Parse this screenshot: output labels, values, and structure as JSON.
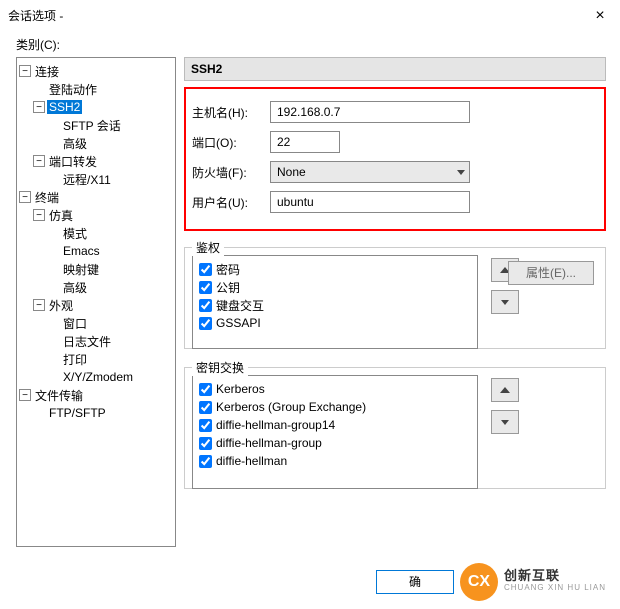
{
  "window": {
    "title": "会话选项 -",
    "close": "×"
  },
  "category_label": "类别(C):",
  "tree": {
    "n_conn": "连接",
    "n_login": "登陆动作",
    "n_ssh2": "SSH2",
    "n_sftp": "SFTP 会话",
    "n_adv1": "高级",
    "n_portfwd": "端口转发",
    "n_remote": "远程/X11",
    "n_term": "终端",
    "n_emul": "仿真",
    "n_mode": "模式",
    "n_emacs": "Emacs",
    "n_mapkey": "映射键",
    "n_adv2": "高级",
    "n_look": "外观",
    "n_win": "窗口",
    "n_log": "日志文件",
    "n_print": "打印",
    "n_xyz": "X/Y/Zmodem",
    "n_file": "文件传输",
    "n_ftp": "FTP/SFTP"
  },
  "section_title": "SSH2",
  "form": {
    "host_label": "主机名(H):",
    "host_value": "192.168.0.7",
    "port_label": "端口(O):",
    "port_value": "22",
    "fw_label": "防火墙(F):",
    "fw_value": "None",
    "user_label": "用户名(U):",
    "user_value": "ubuntu"
  },
  "auth": {
    "title": "鉴权",
    "items": [
      "密码",
      "公钥",
      "键盘交互",
      "GSSAPI"
    ],
    "props_btn": "属性(E)..."
  },
  "kex": {
    "title": "密钥交换",
    "items": [
      "Kerberos",
      "Kerberos (Group Exchange)",
      "diffie-hellman-group14",
      "diffie-hellman-group",
      "diffie-hellman"
    ]
  },
  "ok_label": "确",
  "logo": {
    "glyph": "CX",
    "brand_cn": "创新互联",
    "brand_en": "CHUANG XIN HU LIAN"
  }
}
